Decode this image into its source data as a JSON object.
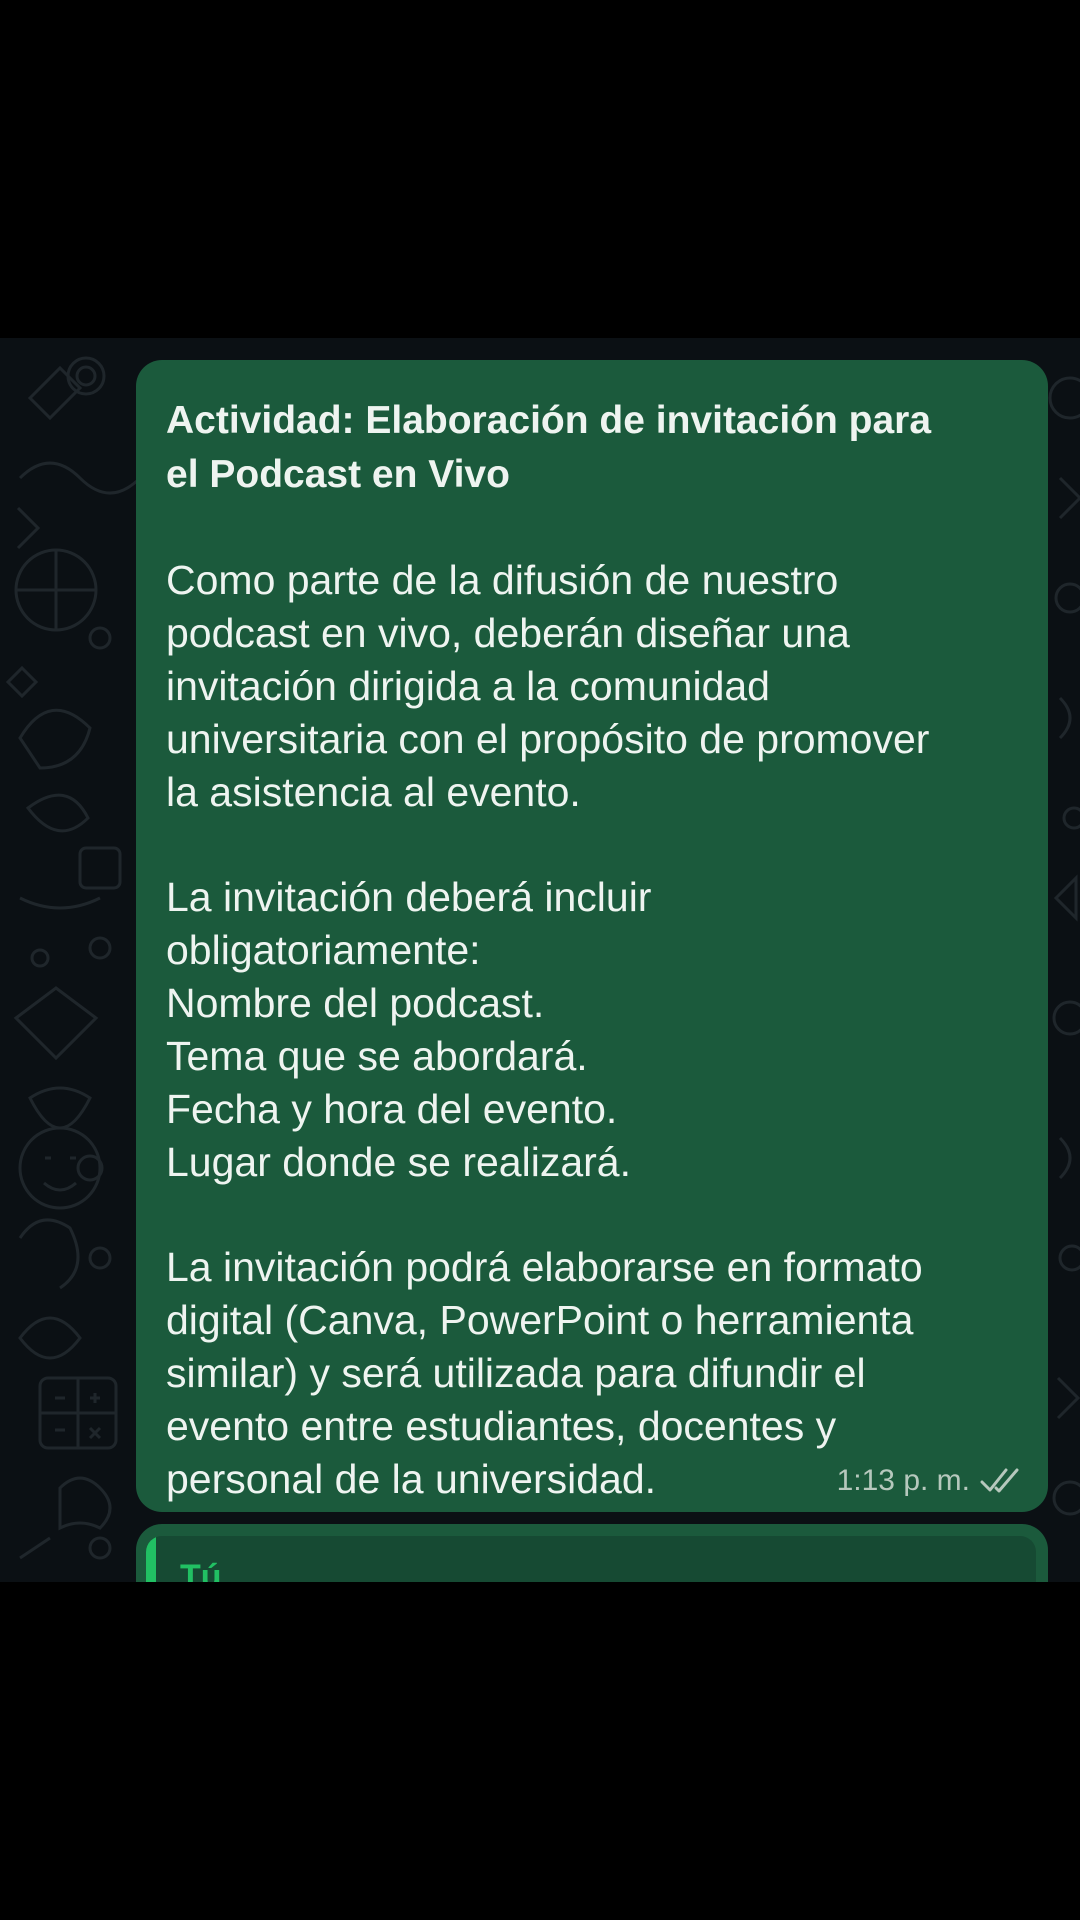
{
  "message": {
    "title_lines": [
      "Actividad: Elaboración de invitación para",
      "el Podcast en Vivo"
    ],
    "paragraph1": [
      "Como parte de la difusión de nuestro",
      "podcast en vivo, deberán diseñar una",
      "invitación dirigida a la comunidad",
      "universitaria con el propósito de promover",
      "la asistencia al evento."
    ],
    "paragraph2": [
      "La invitación deberá incluir",
      "obligatoriamente:",
      "Nombre del podcast.",
      "Tema que se abordará.",
      "Fecha y hora del evento.",
      "Lugar donde se realizará."
    ],
    "paragraph3": [
      "La invitación podrá elaborarse en formato",
      "digital (Canva, PowerPoint o herramienta",
      "similar) y será utilizada para difundir el",
      "evento entre estudiantes, docentes y",
      "personal de la universidad."
    ],
    "time": "1:13 p. m.",
    "status_icon": "double-check-icon"
  },
  "next_message": {
    "quoted_author": "Tú"
  },
  "colors": {
    "bubble": "#1b5a3c",
    "chat_background": "#0b1014",
    "quote_accent": "#21c063",
    "text": "#eef4f0"
  }
}
